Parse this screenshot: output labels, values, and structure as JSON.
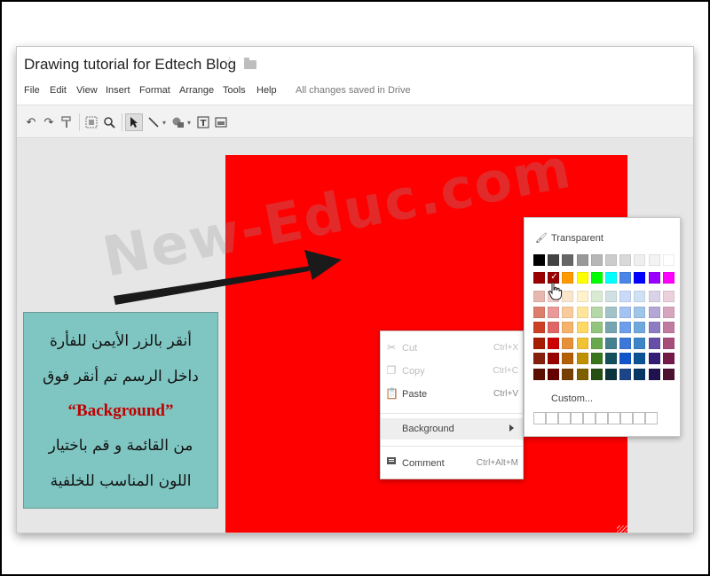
{
  "app": {
    "title": "Drawing tutorial for Edtech Blog",
    "star_icon": "star-outline-icon",
    "folder_icon": "folder-icon",
    "save_status": "All changes saved in Drive"
  },
  "menu": [
    "File",
    "Edit",
    "View",
    "Insert",
    "Format",
    "Arrange",
    "Tools",
    "Help"
  ],
  "toolbar": {
    "tools": [
      "undo-icon",
      "redo-icon",
      "paint-format-icon",
      "select-area-icon",
      "zoom-icon",
      "pointer-icon",
      "line-icon",
      "shape-icon",
      "text-box-icon",
      "image-icon"
    ]
  },
  "canvas": {
    "background_color": "#ff0000"
  },
  "context_menu": {
    "items": [
      {
        "label": "Cut",
        "shortcut": "Ctrl+X",
        "icon": "scissors-icon",
        "enabled": false
      },
      {
        "label": "Copy",
        "shortcut": "Ctrl+C",
        "icon": "copy-icon",
        "enabled": false
      },
      {
        "label": "Paste",
        "shortcut": "Ctrl+V",
        "icon": "paste-icon",
        "enabled": true
      },
      {
        "label": "Background",
        "shortcut": "",
        "icon": "",
        "enabled": true,
        "submenu": true
      },
      {
        "label": "Comment",
        "shortcut": "Ctrl+Alt+M",
        "icon": "comment-icon",
        "enabled": true
      }
    ]
  },
  "palette": {
    "transparent_label": "Transparent",
    "custom_label": "Custom...",
    "selected_color": "#990000",
    "rows": [
      [
        "#000000",
        "#434343",
        "#666666",
        "#999999",
        "#b7b7b7",
        "#cccccc",
        "#d9d9d9",
        "#efefef",
        "#f3f3f3",
        "#ffffff"
      ],
      [
        "#980000",
        "#ff0000",
        "#ff9900",
        "#ffff00",
        "#00ff00",
        "#00ffff",
        "#4a86e8",
        "#0000ff",
        "#9900ff",
        "#ff00ff"
      ],
      [
        "#e6b8af",
        "#f4cccc",
        "#fce5cd",
        "#fff2cc",
        "#d9ead3",
        "#d0e0e3",
        "#c9daf8",
        "#cfe2f3",
        "#d9d2e9",
        "#ead1dc"
      ],
      [
        "#dd7e6b",
        "#ea9999",
        "#f9cb9c",
        "#ffe599",
        "#b6d7a8",
        "#a2c4c9",
        "#a4c2f4",
        "#9fc5e8",
        "#b4a7d6",
        "#d5a6bd"
      ],
      [
        "#cc4125",
        "#e06666",
        "#f6b26b",
        "#ffd966",
        "#93c47d",
        "#76a5af",
        "#6d9eeb",
        "#6fa8dc",
        "#8e7cc3",
        "#c27ba0"
      ],
      [
        "#a61c00",
        "#cc0000",
        "#e69138",
        "#f1c232",
        "#6aa84f",
        "#45818e",
        "#3c78d8",
        "#3d85c6",
        "#674ea7",
        "#a64d79"
      ],
      [
        "#85200c",
        "#990000",
        "#b45f06",
        "#bf9000",
        "#38761d",
        "#134f5c",
        "#1155cc",
        "#0b5394",
        "#351c75",
        "#741b47"
      ],
      [
        "#5b0f00",
        "#660000",
        "#783f04",
        "#7f6000",
        "#274e13",
        "#0c343d",
        "#1c4587",
        "#073763",
        "#20124d",
        "#4c1130"
      ]
    ],
    "custom_slots": 10
  },
  "callout": {
    "lines_top": [
      "أنقر بالزر الأيمن للفأرة",
      "داخل الرسم تم أنقر فوق"
    ],
    "keyword": "“Background”",
    "lines_bottom": [
      "من القائمة و قم باختيار",
      "اللون المناسب للخلفية"
    ],
    "background_color": "#7fc6c2",
    "keyword_color": "#c00000"
  },
  "watermark": "New-Educ.com"
}
